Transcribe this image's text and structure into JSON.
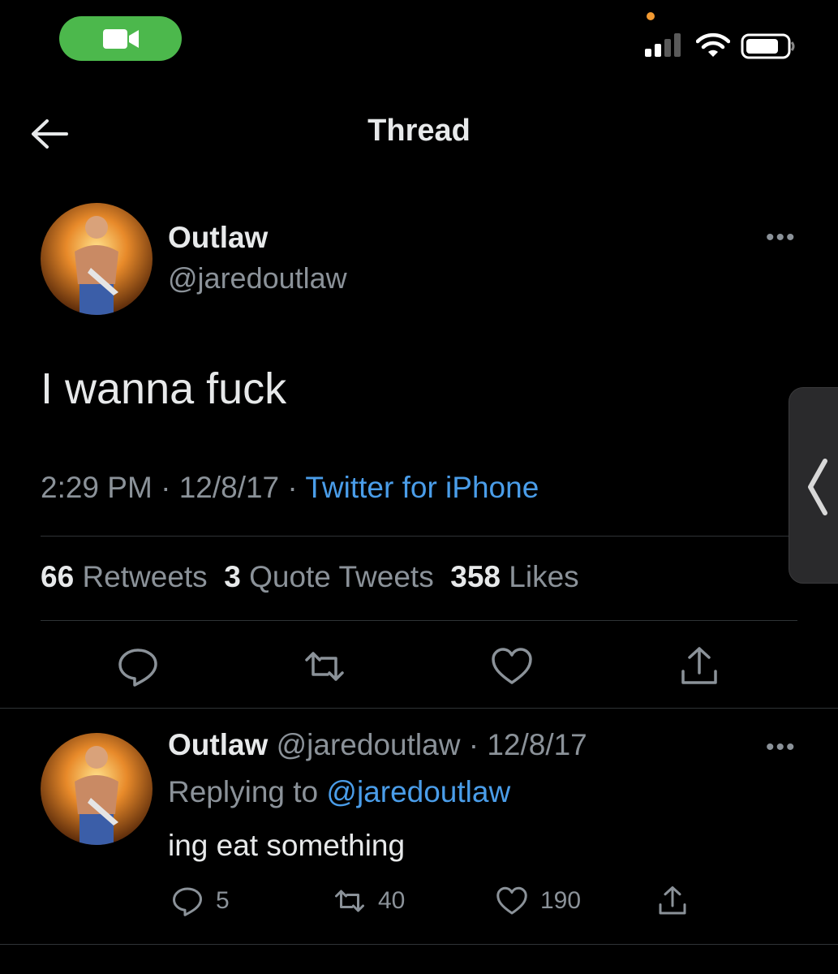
{
  "header": {
    "title": "Thread"
  },
  "tweet": {
    "author_name": "Outlaw",
    "author_handle": "@jaredoutlaw",
    "text": "I wanna fuck",
    "time": "2:29 PM",
    "date": "12/8/17",
    "source": "Twitter for iPhone",
    "separator": " · ",
    "retweets_count": "66",
    "retweets_label": "Retweets",
    "quotes_count": "3",
    "quotes_label": "Quote Tweets",
    "likes_count": "358",
    "likes_label": "Likes"
  },
  "reply": {
    "author_name": "Outlaw",
    "author_handle": "@jaredoutlaw",
    "date": "12/8/17",
    "separator": " · ",
    "replying_to_label": "Replying to",
    "replying_to_handle": "@jaredoutlaw",
    "text": "ing eat something",
    "reply_count": "5",
    "retweet_count": "40",
    "like_count": "190"
  },
  "icons": {
    "status": [
      "video-call-icon",
      "cellular-signal-icon",
      "wifi-icon",
      "battery-icon"
    ],
    "header": [
      "back-arrow-icon"
    ],
    "tweet_actions": [
      "reply-icon",
      "retweet-icon",
      "like-icon",
      "share-icon"
    ],
    "more": "more-options-icon",
    "side": "chevron-left-icon"
  },
  "colors": {
    "background": "#000000",
    "text": "#e7e9ea",
    "secondary_text": "#8b9299",
    "link": "#4a9de9",
    "call_pill": "#4cb84c",
    "divider": "#2f3336"
  }
}
